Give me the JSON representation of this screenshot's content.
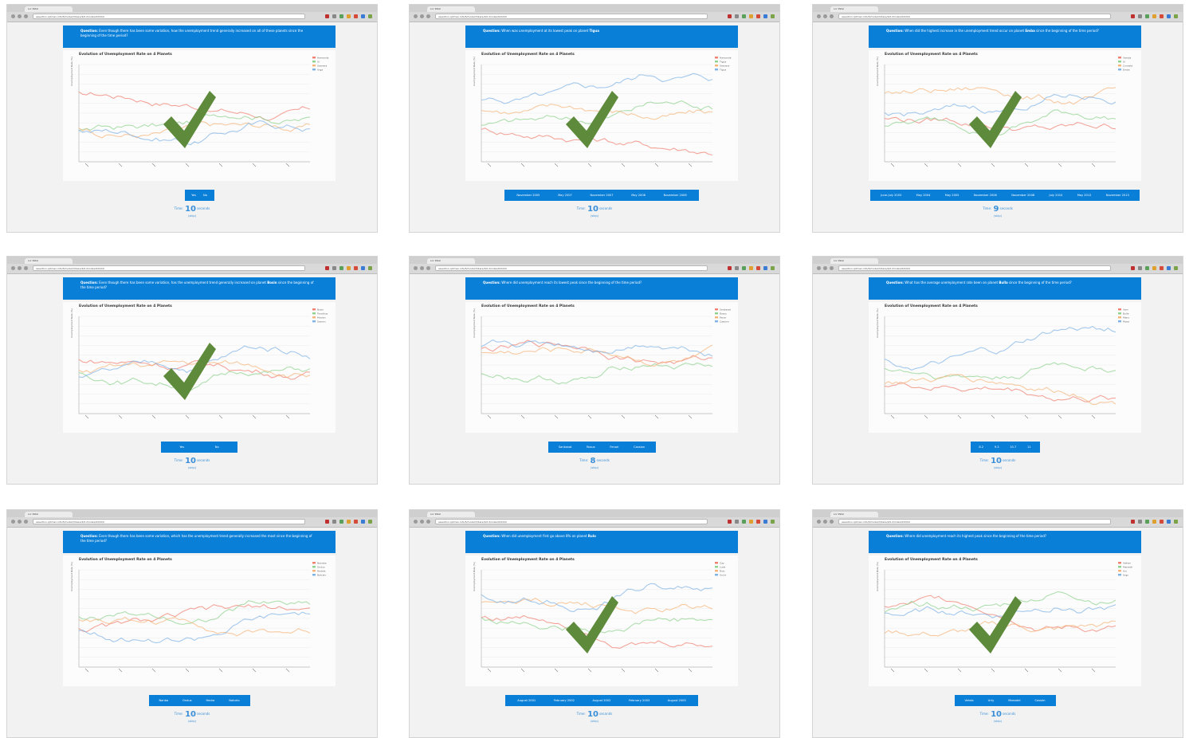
{
  "window": {
    "tab_title": "Lor Patel",
    "url": "assertion.cptmax.info/5/model/3/bars/4/0.2/index/0/0/0/0"
  },
  "colors": {
    "question_bg": "#0a7fd8",
    "button_bg": "#0a7fd8",
    "timer_text": "#3b8fd8",
    "checkmark": "#5e8a3c",
    "series": [
      "#f08070",
      "#8fd18f",
      "#f5b57a",
      "#7fb2e5"
    ]
  },
  "panels": [
    {
      "question_label": "Question:",
      "question_text": "Even though there has been some variation, how the unemployment trend generally increased on all of these planets since the beginning of the time period?",
      "chart_title": "Evolution of Unemployment Rate on 4 Planets",
      "ylabel": "Unemployment Rate (%)",
      "legend": [
        "Hamanda",
        "Ul",
        "Saanera",
        "Urga"
      ],
      "buttons": [
        "Yes",
        "No"
      ],
      "timer_prefix": "Time:",
      "timer_value": "10",
      "timer_suffix": "seconds",
      "skip": "(skip)",
      "correct": true
    },
    {
      "question_label": "Question:",
      "question_text": "When was unemployment at its lowest peak on planet",
      "question_bold": "Tigua",
      "chart_title": "Evolution of Unemployment Rate on 4 Planets",
      "ylabel": "Unemployment Rate (%)",
      "legend": [
        "Hamanda",
        "Tigua",
        "Saanera",
        "Tigua"
      ],
      "buttons": [
        "November 2005",
        "May 2007",
        "November 2007",
        "May 2008",
        "November 2008"
      ],
      "timer_prefix": "Time:",
      "timer_value": "10",
      "timer_suffix": "seconds",
      "skip": "(skip)",
      "correct": true
    },
    {
      "question_label": "Question:",
      "question_text": "When did the highest increase in the unemployment trend occur on planet",
      "question_bold": "Emba",
      "question_text2": "since the beginning of the time period?",
      "chart_title": "Evolution of Unemployment Rate on 4 Planets",
      "ylabel": "Unemployment Rate (%)",
      "legend": [
        "Vamba",
        "Ul",
        "Conseta",
        "Emba"
      ],
      "buttons": [
        "June-July 2003",
        "May 2004",
        "May 2005",
        "November 2006",
        "November 2008",
        "July 2010",
        "May 2012",
        "November 2013"
      ],
      "timer_prefix": "Time:",
      "timer_value": "9",
      "timer_suffix": "seconds",
      "skip": "(skip)",
      "correct": true
    },
    {
      "question_label": "Question:",
      "question_text": "Even though there has been some variation, has the unemployment trend generally increased on planet",
      "question_bold": "Bosin",
      "question_text2": "since the beginning of the time period?",
      "chart_title": "Evolution of Unemployment Rate on 4 Planets",
      "ylabel": "Unemployment Rate (%)",
      "legend": [
        "Bosin",
        "Tonsthus",
        "Mosien",
        "Saaron"
      ],
      "buttons": [
        "Yes",
        "No"
      ],
      "timer_prefix": "Time:",
      "timer_value": "10",
      "timer_suffix": "seconds",
      "skip": "(skip)",
      "correct": true
    },
    {
      "question_label": "Question:",
      "question_text": "Where did unemployment reach its lowest peak since the beginning of the time period?",
      "chart_title": "Evolution of Unemployment Rate on 4 Planets",
      "ylabel": "Unemployment Rate (%)",
      "legend": [
        "Sankasat",
        "Rosos",
        "Fenar",
        "Cassion"
      ],
      "buttons": [
        "Sankasat",
        "Rosus",
        "Fenari",
        "Cassion"
      ],
      "timer_prefix": "Time:",
      "timer_value": "8",
      "timer_suffix": "seconds",
      "skip": "(skip)",
      "correct": false
    },
    {
      "question_label": "Question:",
      "question_text": "What has the average unemployment rate been on planet",
      "question_bold": "Bulla",
      "question_text2": "since the beginning of the time period?",
      "chart_title": "Evolution of Unemployment Rate on 4 Planets",
      "ylabel": "Unemployment Rate (%)",
      "legend": [
        "Vam",
        "Bulla",
        "Mano",
        "Mosa"
      ],
      "buttons": [
        "8.2",
        "9.3",
        "10.7",
        "11"
      ],
      "timer_prefix": "Time:",
      "timer_value": "10",
      "timer_suffix": "seconds",
      "skip": "(skip)",
      "correct": false
    },
    {
      "question_label": "Question:",
      "question_text": "Even though there has been some variation, which has the unemployment trend generally increased the most since the beginning of the time period?",
      "chart_title": "Evolution of Unemployment Rate on 4 Planets",
      "ylabel": "Unemployment Rate (%)",
      "legend": [
        "Nanaba",
        "Ondus",
        "Hedela",
        "Nalcelo"
      ],
      "buttons": [
        "Nanba",
        "Ondus",
        "Hedra",
        "Nalcelo"
      ],
      "timer_prefix": "Time:",
      "timer_value": "10",
      "timer_suffix": "seconds",
      "skip": "(skip)",
      "correct": false
    },
    {
      "question_label": "Question:",
      "question_text": "When did unemployment first go above 8% on planet",
      "question_bold": "Rulo",
      "chart_title": "Evolution of Unemployment Rate on 4 Planets",
      "ylabel": "Unemployment Rate (%)",
      "legend": [
        "Cay",
        "Lude",
        "Rulo",
        "Urula"
      ],
      "buttons": [
        "August 2001",
        "February 2002",
        "August 2002",
        "February 2003",
        "August 2003"
      ],
      "timer_prefix": "Time:",
      "timer_value": "10",
      "timer_suffix": "seconds",
      "skip": "(skip)",
      "correct": true
    },
    {
      "question_label": "Question:",
      "question_text": "Where did unemployment reach its highest peak since the beginning of the time period?",
      "chart_title": "Evolution of Unemployment Rate on 4 Planets",
      "ylabel": "Unemployment Rate (%)",
      "legend": [
        "Velhen",
        "Maredel",
        "Uru",
        "Urgs"
      ],
      "buttons": [
        "Vehda",
        "Urty",
        "Meandel",
        "Cassim"
      ],
      "timer_prefix": "Time:",
      "timer_value": "10",
      "timer_suffix": "seconds",
      "skip": "(skip)",
      "correct": true
    }
  ]
}
